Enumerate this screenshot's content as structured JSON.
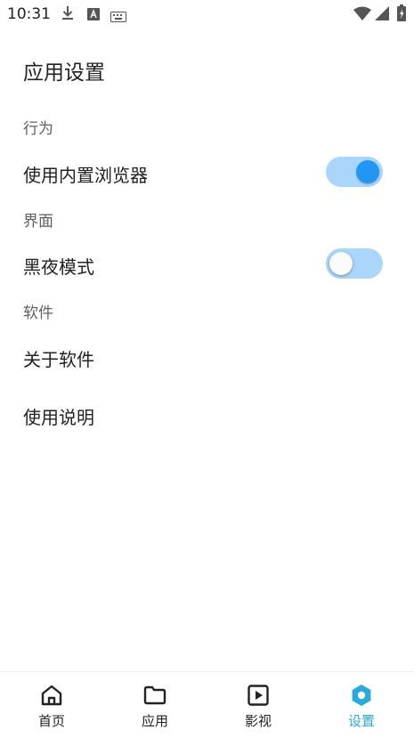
{
  "status_bar": {
    "time": "10:31",
    "notification_icons": [
      "download-icon",
      "a-box-icon",
      "keyboard-icon"
    ],
    "right_icons": [
      "wifi-icon",
      "signal-icon",
      "battery-charging-icon"
    ]
  },
  "page": {
    "title": "应用设置"
  },
  "sections": {
    "behavior": {
      "header": "行为",
      "builtin_browser": {
        "label": "使用内置浏览器",
        "enabled": true
      }
    },
    "interface": {
      "header": "界面",
      "dark_mode": {
        "label": "黑夜模式",
        "enabled": false
      }
    },
    "software": {
      "header": "软件",
      "about": {
        "label": "关于软件"
      },
      "instructions": {
        "label": "使用说明"
      }
    }
  },
  "bottom_nav": {
    "items": [
      {
        "label": "首页",
        "icon": "home-icon",
        "active": false
      },
      {
        "label": "应用",
        "icon": "folder-icon",
        "active": false
      },
      {
        "label": "影视",
        "icon": "play-square-icon",
        "active": false
      },
      {
        "label": "设置",
        "icon": "settings-hexagon-icon",
        "active": true
      }
    ],
    "active_color": "#29a9dc"
  },
  "colors": {
    "switch_track": "#aad6fb",
    "switch_thumb_on": "#2196f3",
    "switch_thumb_off": "#fafafa"
  }
}
